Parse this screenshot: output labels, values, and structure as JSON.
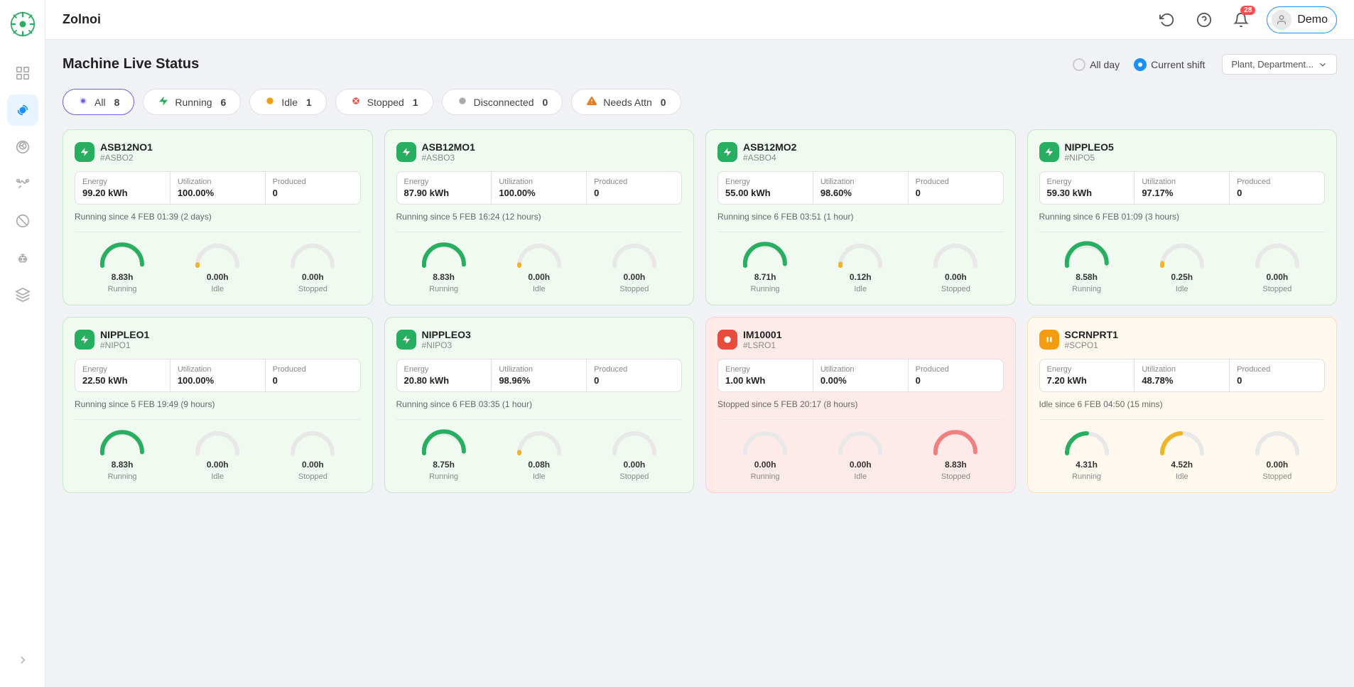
{
  "app": {
    "brand": "Zolnoi",
    "user": "Demo"
  },
  "navbar": {
    "refresh_title": "Refresh",
    "help_title": "Help",
    "notifications_title": "Notifications",
    "notifications_count": "28",
    "user_label": "Demo"
  },
  "page": {
    "title": "Machine Live Status",
    "radio_allday": "All day",
    "radio_current_shift": "Current shift",
    "dropdown_label": "Plant, Department..."
  },
  "filters": [
    {
      "id": "all",
      "label": "All",
      "count": "8",
      "active": true,
      "dot_class": "dot-all"
    },
    {
      "id": "running",
      "label": "Running",
      "count": "6",
      "active": false,
      "dot_class": "dot-running"
    },
    {
      "id": "idle",
      "label": "Idle",
      "count": "1",
      "active": false,
      "dot_class": "dot-idle"
    },
    {
      "id": "stopped",
      "label": "Stopped",
      "count": "1",
      "active": false,
      "dot_class": "dot-stopped"
    },
    {
      "id": "disconnected",
      "label": "Disconnected",
      "count": "0",
      "active": false,
      "dot_class": "dot-disconnected"
    },
    {
      "id": "needs-attn",
      "label": "Needs Attn",
      "count": "0",
      "active": false,
      "dot_class": "dot-needs-attn"
    }
  ],
  "machines": [
    {
      "id": "ASB12NO1",
      "code": "#ASBO2",
      "status": "running",
      "energy": "99.20 kWh",
      "utilization": "100.00%",
      "produced": "0",
      "status_text": "Running since 4 FEB 01:39 (2 days)",
      "running_h": "8.83h",
      "idle_h": "0.00h",
      "stopped_h": "0.00h",
      "running_pct": 98,
      "idle_pct": 2,
      "stopped_pct": 1
    },
    {
      "id": "ASB12MO1",
      "code": "#ASBO3",
      "status": "running",
      "energy": "87.90 kWh",
      "utilization": "100.00%",
      "produced": "0",
      "status_text": "Running since 5 FEB 16:24 (12 hours)",
      "running_h": "8.83h",
      "idle_h": "0.00h",
      "stopped_h": "0.00h",
      "running_pct": 98,
      "idle_pct": 2,
      "stopped_pct": 1
    },
    {
      "id": "ASB12MO2",
      "code": "#ASBO4",
      "status": "running",
      "energy": "55.00 kWh",
      "utilization": "98.60%",
      "produced": "0",
      "status_text": "Running since 6 FEB 03:51 (1 hour)",
      "running_h": "8.71h",
      "idle_h": "0.12h",
      "stopped_h": "0.00h",
      "running_pct": 97,
      "idle_pct": 3,
      "stopped_pct": 1
    },
    {
      "id": "NIPPLEO5",
      "code": "#NIPO5",
      "status": "running",
      "energy": "59.30 kWh",
      "utilization": "97.17%",
      "produced": "0",
      "status_text": "Running since 6 FEB 01:09 (3 hours)",
      "running_h": "8.58h",
      "idle_h": "0.25h",
      "stopped_h": "0.00h",
      "running_pct": 96,
      "idle_pct": 4,
      "stopped_pct": 1
    },
    {
      "id": "NIPPLEO1",
      "code": "#NIPO1",
      "status": "running",
      "energy": "22.50 kWh",
      "utilization": "100.00%",
      "produced": "0",
      "status_text": "Running since 5 FEB 19:49 (9 hours)",
      "running_h": "8.83h",
      "idle_h": "0.00h",
      "stopped_h": "0.00h",
      "running_pct": 98,
      "idle_pct": 1,
      "stopped_pct": 1
    },
    {
      "id": "NIPPLEO3",
      "code": "#NIPO3",
      "status": "running",
      "energy": "20.80 kWh",
      "utilization": "98.96%",
      "produced": "0",
      "status_text": "Running since 6 FEB 03:35 (1 hour)",
      "running_h": "8.75h",
      "idle_h": "0.08h",
      "stopped_h": "0.00h",
      "running_pct": 97,
      "idle_pct": 2,
      "stopped_pct": 1
    },
    {
      "id": "IM10001",
      "code": "#LSRO1",
      "status": "stopped",
      "energy": "1.00 kWh",
      "utilization": "0.00%",
      "produced": "0",
      "status_text": "Stopped since 5 FEB 20:17 (8 hours)",
      "running_h": "0.00h",
      "idle_h": "0.00h",
      "stopped_h": "8.83h",
      "running_pct": 1,
      "idle_pct": 1,
      "stopped_pct": 98
    },
    {
      "id": "SCRNPRT1",
      "code": "#SCPO1",
      "status": "idle",
      "energy": "7.20 kWh",
      "utilization": "48.78%",
      "produced": "0",
      "status_text": "Idle since 6 FEB 04:50 (15 mins)",
      "running_h": "4.31h",
      "idle_h": "4.52h",
      "stopped_h": "0.00h",
      "running_pct": 50,
      "idle_pct": 48,
      "stopped_pct": 1
    }
  ]
}
